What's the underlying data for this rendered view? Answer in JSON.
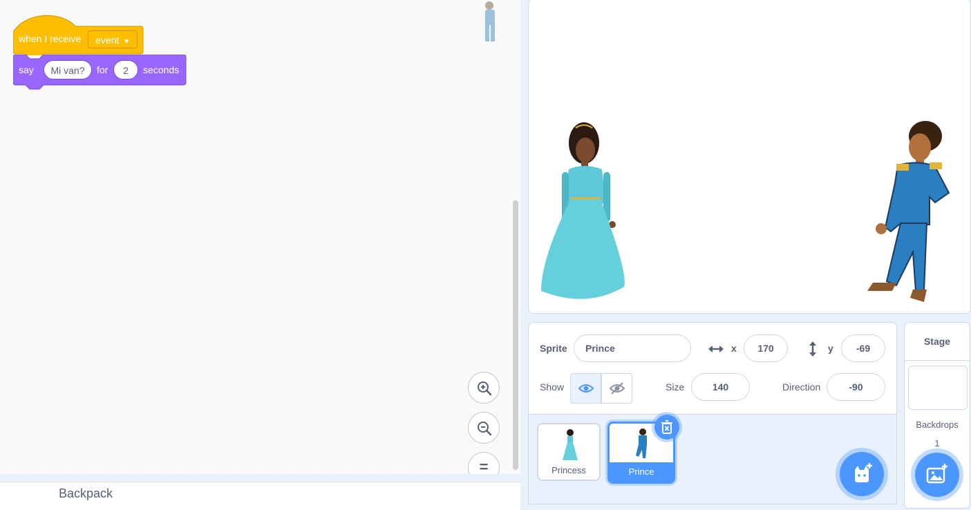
{
  "workspace": {
    "hat_block": {
      "text": "when I receive",
      "dropdown_value": "event"
    },
    "say_block": {
      "say": "say",
      "message": "Mi van?",
      "for": "for",
      "seconds_value": "2",
      "seconds": "seconds"
    },
    "zoom_reset_symbol": "="
  },
  "backpack": {
    "label": "Backpack"
  },
  "sprite_info": {
    "sprite_label": "Sprite",
    "sprite_name": "Prince",
    "x_label": "x",
    "x_value": "170",
    "y_label": "y",
    "y_value": "-69",
    "show_label": "Show",
    "size_label": "Size",
    "size_value": "140",
    "direction_label": "Direction",
    "direction_value": "-90"
  },
  "sprites": [
    {
      "name": "Princess",
      "selected": false
    },
    {
      "name": "Prince",
      "selected": true
    }
  ],
  "stage_panel": {
    "title": "Stage",
    "backdrops_label": "Backdrops",
    "backdrops_count": "1"
  },
  "colors": {
    "events": "#ffbf00",
    "looks": "#9966ff",
    "accent": "#4c97ff"
  },
  "icons": [
    "zoom-in-icon",
    "zoom-out-icon",
    "zoom-reset-icon",
    "eye-icon",
    "eye-off-icon",
    "delete-icon",
    "add-sprite-icon",
    "add-backdrop-icon",
    "arrows-horizontal-icon",
    "arrows-vertical-icon"
  ]
}
